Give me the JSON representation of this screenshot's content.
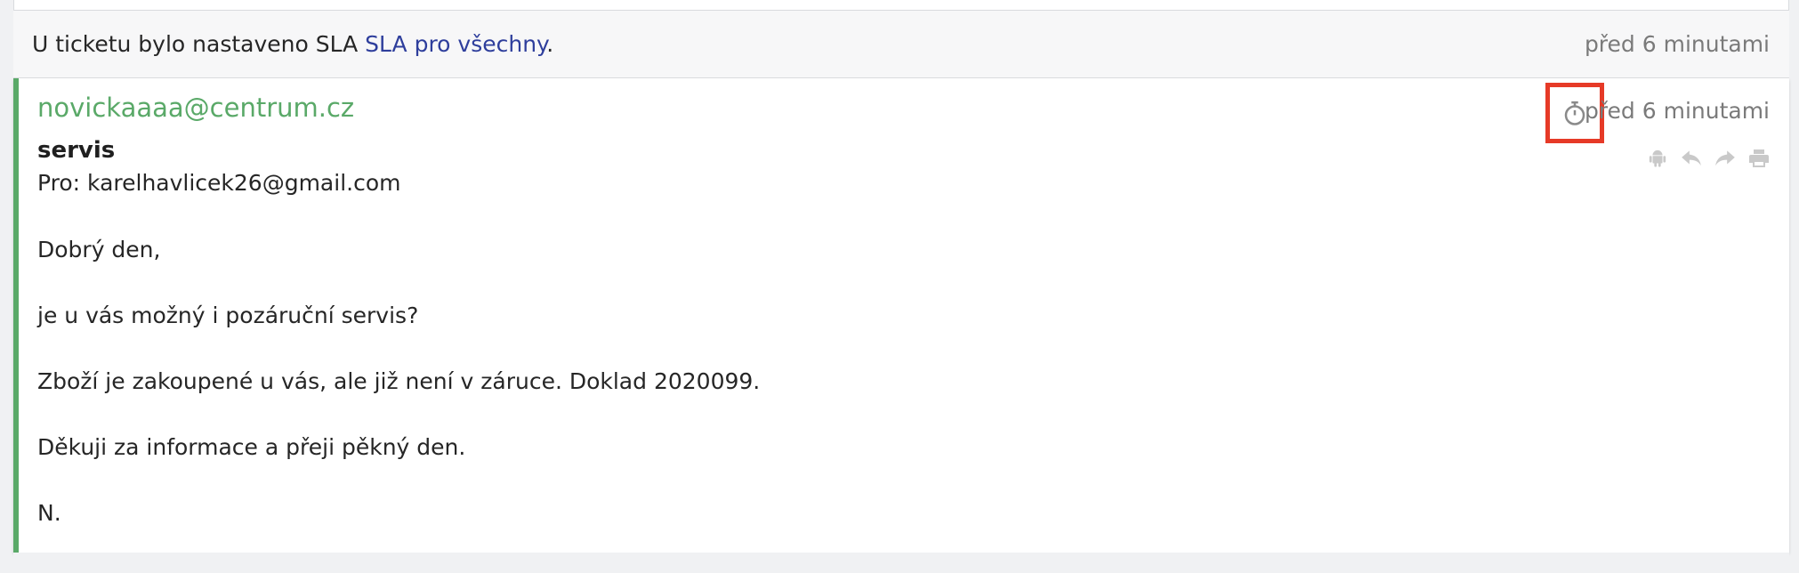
{
  "sla_event": {
    "text_before": "U ticketu bylo nastaveno SLA ",
    "link": "SLA pro všechny",
    "text_after": ".",
    "time": "před 6 minutami"
  },
  "message": {
    "sender": "novickaaaa@centrum.cz",
    "time": "před 6 minutami",
    "subject": "servis",
    "to": "Pro: karelhavlicek26@gmail.com",
    "paragraphs": [
      "Dobrý den,",
      "je u vás možný i pozáruční servis?",
      "Zboží je zakoupené u vás, ale již není v záruce. Doklad 2020099.",
      "Děkuji za informace a přeji pěkný den.",
      "N."
    ],
    "actions": [
      "android-icon",
      "reply-icon",
      "forward-icon",
      "print-icon"
    ]
  },
  "colors": {
    "accent_green": "#5aa968",
    "link_blue": "#2e3e9c",
    "highlight_red": "#e63a27",
    "muted": "#7a7a7a"
  }
}
